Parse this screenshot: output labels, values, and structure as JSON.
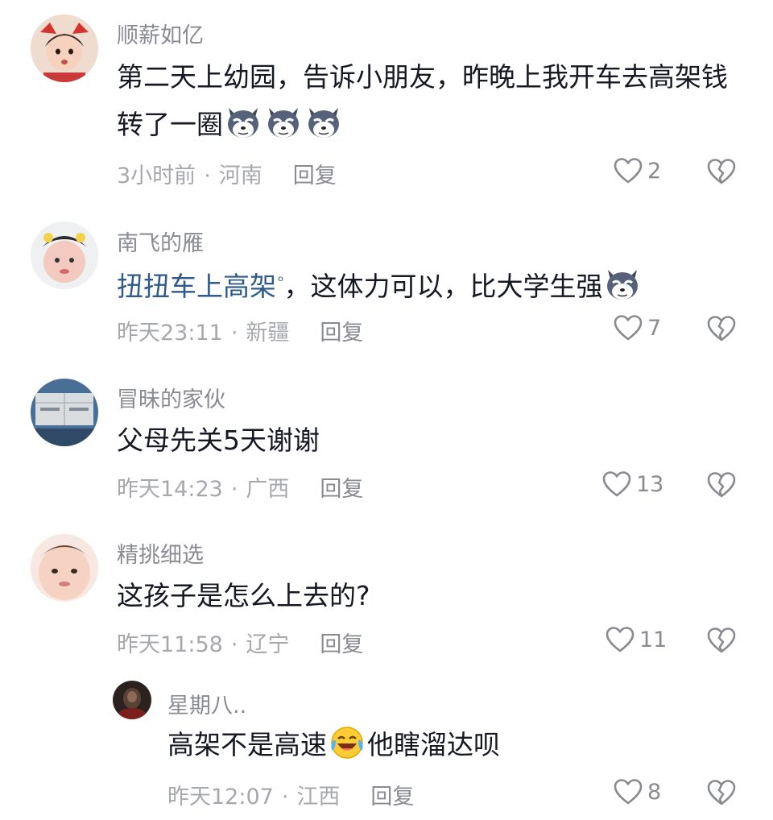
{
  "comments": [
    {
      "username": "顺薪如亿",
      "text_before": "第二天上幼园，告诉小朋友，昨晚上我开车去高架钱转了一圈",
      "emojis": [
        "wolf-emoji",
        "wolf-emoji",
        "wolf-emoji"
      ],
      "time": "3小时前",
      "location": "河南",
      "reply_label": "回复",
      "likes": "2"
    },
    {
      "username": "南飞的雁",
      "link_text": "扭扭车上高架",
      "text_after": "，这体力可以，比大学生强",
      "emojis": [
        "wolf-emoji"
      ],
      "time": "昨天23:11",
      "location": "新疆",
      "reply_label": "回复",
      "likes": "7"
    },
    {
      "username": "冒昧的家伙",
      "text_before": "父母先关5天谢谢",
      "time": "昨天14:23",
      "location": "广西",
      "reply_label": "回复",
      "likes": "13"
    },
    {
      "username": "精挑细选",
      "text_before": "这孩子是怎么上去的?",
      "time": "昨天11:58",
      "location": "辽宁",
      "reply_label": "回复",
      "likes": "11"
    },
    {
      "username": "星期八..",
      "text_before": "高架不是高速",
      "emojis": [
        "laugh-cry-emoji"
      ],
      "text_after": "他瞎溜达呗",
      "time": "昨天12:07",
      "location": "江西",
      "reply_label": "回复",
      "likes": "8"
    }
  ],
  "colors": {
    "username": "#8a8b91",
    "body_text": "#161823",
    "meta_text": "#a7a8ad",
    "link": "#2f5a8a"
  }
}
